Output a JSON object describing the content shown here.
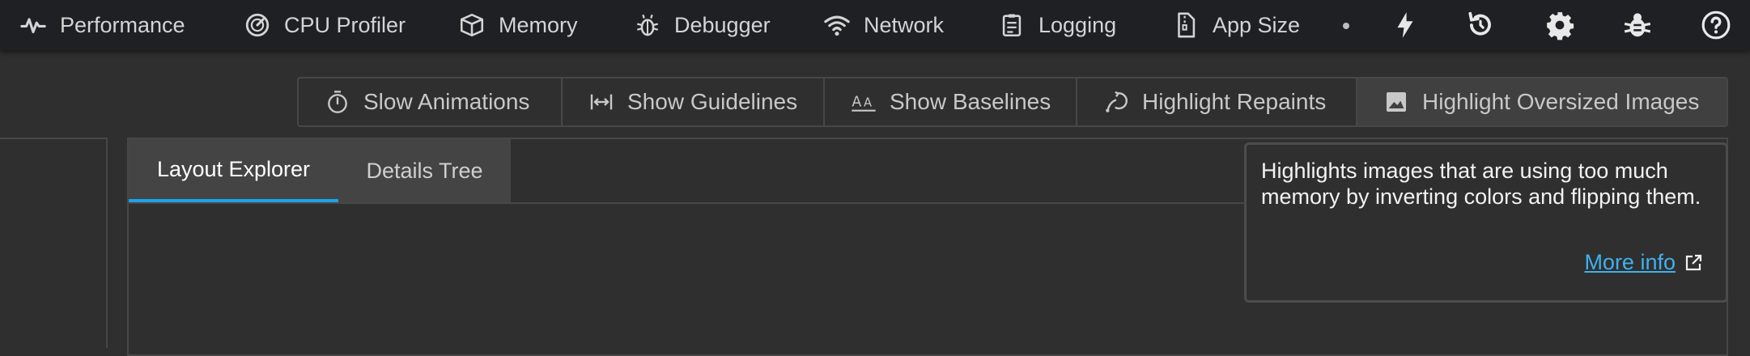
{
  "nav": {
    "tabs": [
      {
        "label": "Performance",
        "icon": "performance-icon"
      },
      {
        "label": "CPU Profiler",
        "icon": "gauge-icon"
      },
      {
        "label": "Memory",
        "icon": "memory-box-icon"
      },
      {
        "label": "Debugger",
        "icon": "bug-icon"
      },
      {
        "label": "Network",
        "icon": "wifi-icon"
      },
      {
        "label": "Logging",
        "icon": "clipboard-icon"
      },
      {
        "label": "App Size",
        "icon": "file-zip-icon"
      }
    ],
    "actions": [
      {
        "icon": "lightning-icon"
      },
      {
        "icon": "hot-restart-icon"
      },
      {
        "icon": "settings-gear-icon"
      },
      {
        "icon": "bug-report-icon"
      },
      {
        "icon": "help-icon"
      }
    ]
  },
  "toolbar": {
    "buttons": [
      {
        "label": "Slow Animations",
        "icon": "timer-icon"
      },
      {
        "label": "Show Guidelines",
        "icon": "guidelines-icon"
      },
      {
        "label": "Show Baselines",
        "icon": "baselines-icon"
      },
      {
        "label": "Highlight Repaints",
        "icon": "repaint-icon"
      },
      {
        "label": "Highlight Oversized Images",
        "icon": "image-icon"
      }
    ]
  },
  "view": {
    "tabs": [
      {
        "label": "Layout Explorer",
        "selected": true
      },
      {
        "label": "Details Tree",
        "selected": false
      }
    ]
  },
  "tooltip": {
    "text": "Highlights images that are using too much memory by inverting colors and flipping them.",
    "link_label": "More info",
    "link_icon": "open-in-new-icon"
  },
  "colors": {
    "accent": "#1aa3e8",
    "link": "#3fb1ee",
    "nav_background": "#1f2023",
    "page_background": "#2f2f2f"
  }
}
